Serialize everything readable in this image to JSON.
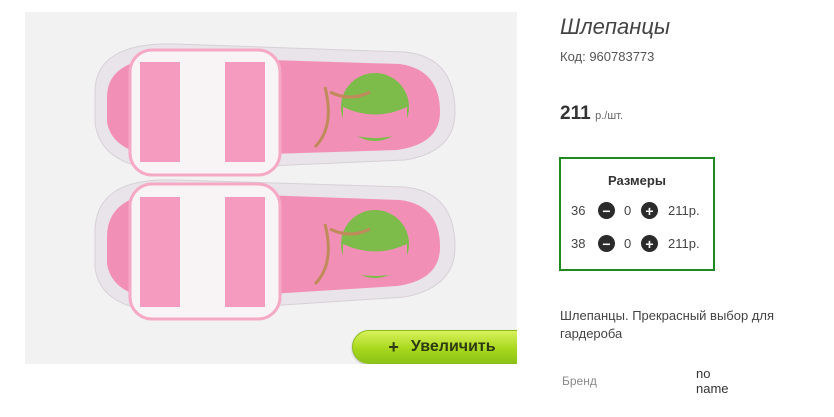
{
  "product": {
    "title": "Шлепанцы",
    "code": "Код: 960783773",
    "price": "211",
    "price_unit": "р./шт.",
    "description": "Шлепанцы. Прекрасный выбор для гардероба"
  },
  "gallery": {
    "zoom_label": "Увеличить",
    "zoom_icon": "+"
  },
  "sizes": {
    "header": "Размеры",
    "rows": [
      {
        "size": "36",
        "qty": "0",
        "price": "211р."
      },
      {
        "size": "38",
        "qty": "0",
        "price": "211р."
      }
    ]
  },
  "attributes": {
    "brand_label": "Бренд",
    "brand_value": "no name"
  },
  "colors": {
    "sandal_pink": "#f48cb0",
    "sole": "#f1e6ee",
    "accent_green": "#1f8a1f"
  }
}
